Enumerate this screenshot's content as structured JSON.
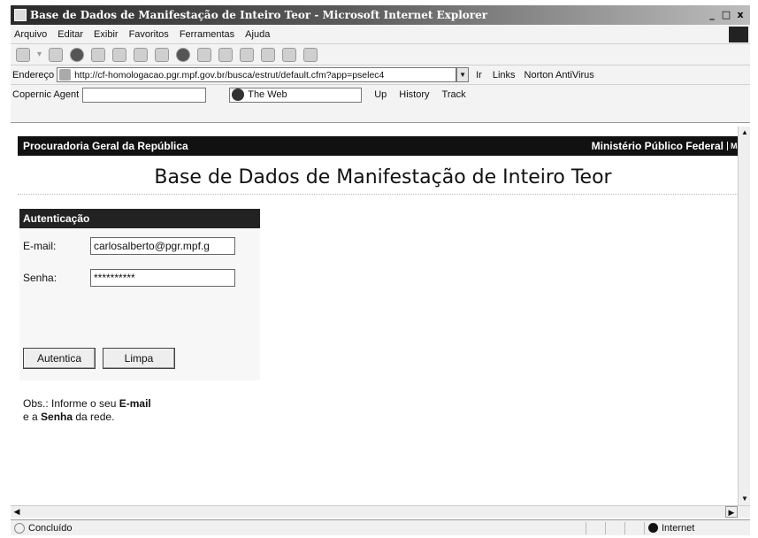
{
  "window": {
    "title": "Base de Dados de Manifestação de Inteiro Teor - Microsoft Internet Explorer",
    "controls": [
      "_",
      "□",
      "x"
    ]
  },
  "menubar": {
    "items": [
      "Arquivo",
      "Editar",
      "Exibir",
      "Favoritos",
      "Ferramentas",
      "Ajuda"
    ]
  },
  "address": {
    "label": "Endereço",
    "url": "http://cf-homologacao.pgr.mpf.gov.br/busca/estrut/default.cfm?app=pselec4",
    "go_label": "Ir",
    "links_label": "Links",
    "norton_label": "Norton AntiVirus"
  },
  "copernic": {
    "label": "Copernic Agent",
    "search_scope": "The Web",
    "up_label": "Up",
    "history_label": "History",
    "track_label": "Track"
  },
  "page": {
    "org": "Procuradoria Geral da República",
    "mpf": "Ministério Público Federal",
    "menu": "Menu",
    "title": "Base de Dados de Manifestação de Inteiro Teor",
    "auth": {
      "heading": "Autenticação",
      "email_label": "E-mail:",
      "email_value": "carlosalberto@pgr.mpf.g",
      "password_label": "Senha:",
      "password_value": "**********",
      "submit_label": "Autentica",
      "clear_label": "Limpa",
      "obs_prefix": "Obs.: Informe o seu ",
      "obs_email": "E-mail",
      "obs_middle": "e a ",
      "obs_senha": "Senha",
      "obs_suffix": " da rede."
    }
  },
  "status": {
    "text": "Concluído",
    "zone": "Internet"
  }
}
